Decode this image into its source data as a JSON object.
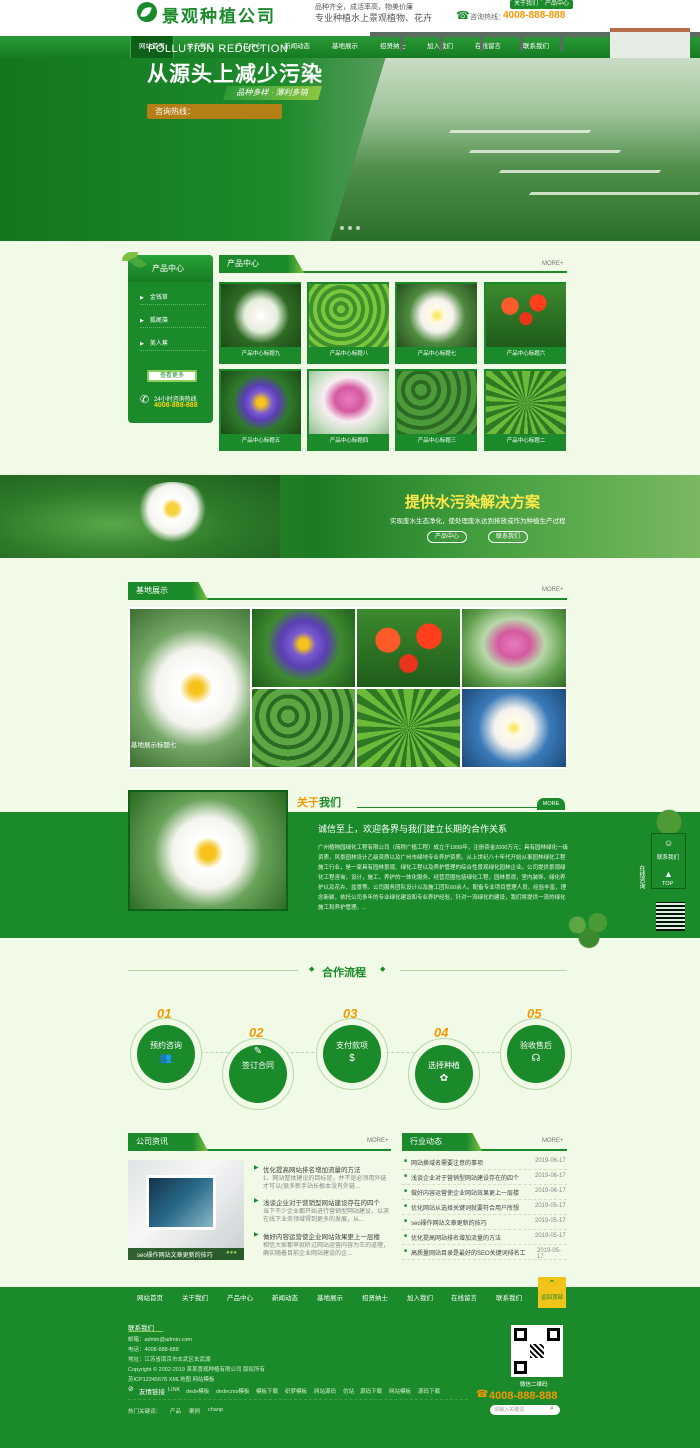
{
  "header": {
    "logo_text": "景观种植公司",
    "slogan_line1": "品种齐全，成活率高，物美价廉",
    "slogan_line2": "专业种植水上景观植物、花卉",
    "top_links": [
      "关于我们",
      "产品中心"
    ],
    "hotline_label": "咨询热线：",
    "hotline_number": "4008-888-888"
  },
  "nav": {
    "items": [
      "网站首页",
      "关于我们",
      "产品中心",
      "新闻动态",
      "基地展示",
      "招贤纳士",
      "加入我们",
      "在线留言",
      "联系我们"
    ],
    "active_index": 0
  },
  "banner": {
    "en_title": "POLLUTION REDUCTION",
    "cn_title": "从源头上减少污染",
    "tag": "品种多样 · 薄利多销",
    "hotline": "咨询热线："
  },
  "products": {
    "side_title": "产品中心",
    "side_items": [
      "金钱草",
      "狐尾藻",
      "美人蕉"
    ],
    "side_more": "查看更多",
    "side_phone_label": "24小时咨询热线",
    "side_phone": "4008-888-888",
    "section_title": "产品中心",
    "more": "MORE+",
    "cards": [
      "产品中心标题九",
      "产品中心标题八",
      "产品中心标题七",
      "产品中心标题六",
      "产品中心标题五",
      "产品中心标题四",
      "产品中心标题三",
      "产品中心标题二"
    ]
  },
  "water_banner": {
    "title": "提供水污染解决方案",
    "subtitle": "实现废水生态净化，使处理废水达到排放或作为种植生产过程",
    "buttons": [
      "产品中心",
      "联系我们"
    ]
  },
  "jidi": {
    "title": "基地展示",
    "more": "MORE+",
    "caption": "基地展示标题七"
  },
  "about": {
    "title_a": "关于",
    "title_b": "我们",
    "more": "MORE",
    "headline": "诚信至上，欢迎各界与我们建立长期的合作关系",
    "body": "广州植物园绿化工程有限公司（简称广植工程）成立于1999年，注册资金2000万元；具有园林绿化一级资质，风景园林设计乙级资质以及广州市绿地专业养护资质。从上世纪八十年代开始从事园林绿化工程施工行业，是一家具有园林景观、绿化工程以及养护管理的综合性景观绿化园林企业。公司提供景观绿化工程咨询，设计，施工，养护的一体化服务。经营范围包括绿化工程，园林景观，室内装饰，绿化养护以及花卉、盆景等。公司服务团队设计以及施工团队60余人。配备专业项目管理人员，经验丰富，理念新颖，依托公司多年的专业绿化建设和专业养护经验，针对一流绿化的建设，我们将提供一流的绿化施工和养护管理。..."
  },
  "float_panel": {
    "items": [
      "联系我们",
      "TOP"
    ],
    "side_label": "在线咨询"
  },
  "process": {
    "title": "合作流程",
    "steps": [
      {
        "num": "01",
        "label": "预约咨询"
      },
      {
        "num": "02",
        "label": "签订合同"
      },
      {
        "num": "03",
        "label": "支付款项"
      },
      {
        "num": "04",
        "label": "选择种植"
      },
      {
        "num": "05",
        "label": "验收售后"
      }
    ]
  },
  "company_news": {
    "title": "公司资讯",
    "more": "MORE+",
    "image_caption": "seo操作网站文章更新的技巧",
    "items": [
      {
        "title": "优化提高网站排名增加流量的方法",
        "desc": "1、网站整体建设的目标是，并不是必须用外链才可以(很多新手站长根本没有外链..."
      },
      {
        "title": "浅谈企业对于营销型网站建设存在的四个",
        "desc": "当下不少企业都开始进行营销型网站建设，以求在线下业务领域得到更多的发展，从..."
      },
      {
        "title": "做好内容运营使企业网站效果更上一层楼",
        "desc": "相信大家都早就听过网站运营内容为王的道理，确实随着目前企业网站建设的企..."
      }
    ]
  },
  "industry_news": {
    "title": "行业动态",
    "more": "MORE+",
    "items": [
      {
        "title": "网站换域名需要注意的事项",
        "date": "2019-06-17"
      },
      {
        "title": "浅谈企业对于营销型网站建设存在的四个",
        "date": "2019-06-17"
      },
      {
        "title": "做好内容运营使企业网站效果更上一层楼",
        "date": "2019-06-17"
      },
      {
        "title": "优化网站从选择关键词就要符合用户所想",
        "date": "2019-05-17"
      },
      {
        "title": "seo操作网站文章更新的技巧",
        "date": "2019-05-17"
      },
      {
        "title": "优化提高网站排名增加流量的方法",
        "date": "2019-05-17"
      },
      {
        "title": "高质量网站目录是最好的SEO关键词排名工",
        "date": "2019-05-17"
      }
    ]
  },
  "footer_nav": {
    "items": [
      "网站首页",
      "关于我们",
      "产品中心",
      "新闻动态",
      "基地展示",
      "招贤纳士",
      "加入我们",
      "在线留言",
      "联系我们"
    ],
    "back_top": "返回顶部"
  },
  "footer": {
    "contact_title": "联系我们",
    "email": "邮箱：admin@admin.com",
    "tel": "电话：4008-888-888",
    "address": "地址：江苏省南京市玄武区玄武湖",
    "copyright": "Copyright © 2002-2019 某某景观种植有限公司 版权所有",
    "icp": "苏ICP12345678    XML地图    网站模板",
    "links_title": "友情链接",
    "links_en": "LINK",
    "links": [
      "dede模板",
      "dedecms模板",
      "模板下载",
      "织梦模板",
      "网站源码",
      "仿站",
      "源码下载",
      "网站模板",
      "源码下载"
    ],
    "hot_keywords": "热门关键词：",
    "keywords": [
      "产品",
      "案例",
      "chanp"
    ],
    "qr_label": "微信二维码",
    "phone": "4008-888-888",
    "search_placeholder": "请输入关键词"
  }
}
